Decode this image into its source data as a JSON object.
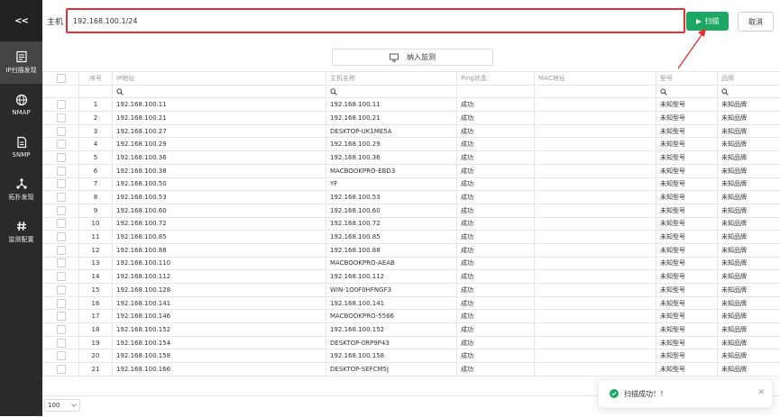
{
  "sidebar": {
    "collapse_label": "<<",
    "items": [
      {
        "label": "IP扫描发现",
        "icon": "scan-list-icon",
        "active": true
      },
      {
        "label": "NMAP",
        "icon": "globe-icon",
        "active": false
      },
      {
        "label": "SNMP",
        "icon": "snmp-doc-icon",
        "active": false
      },
      {
        "label": "拓扑发现",
        "icon": "topology-icon",
        "active": false
      },
      {
        "label": "监测配置",
        "icon": "hash-icon",
        "active": false
      }
    ]
  },
  "toolbar": {
    "host_label": "主机",
    "host_value": "192.168.100.1/24",
    "scan_label": "扫描",
    "cancel_label": "取消",
    "monitor_label": "纳入监测"
  },
  "table": {
    "columns": [
      "序号",
      "IP地址",
      "主机名称",
      "Ping状态",
      "MAC地址",
      "型号",
      "品牌"
    ],
    "rows": [
      [
        "1",
        "192.168.100.11",
        "192.168.100.11",
        "成功",
        "",
        "未知型号",
        "未知品牌"
      ],
      [
        "2",
        "192.168.100.21",
        "192.168.100.21",
        "成功",
        "",
        "未知型号",
        "未知品牌"
      ],
      [
        "3",
        "192.168.100.27",
        "DESKTOP-UK1ME5A",
        "成功",
        "",
        "未知型号",
        "未知品牌"
      ],
      [
        "4",
        "192.168.100.29",
        "192.168.100.29",
        "成功",
        "",
        "未知型号",
        "未知品牌"
      ],
      [
        "5",
        "192.168.100.36",
        "192.168.100.36",
        "成功",
        "",
        "未知型号",
        "未知品牌"
      ],
      [
        "6",
        "192.168.100.38",
        "MACBOOKPRO-EBD3",
        "成功",
        "",
        "未知型号",
        "未知品牌"
      ],
      [
        "7",
        "192.168.100.50",
        "YF",
        "成功",
        "",
        "未知型号",
        "未知品牌"
      ],
      [
        "8",
        "192.168.100.53",
        "192.168.100.53",
        "成功",
        "",
        "未知型号",
        "未知品牌"
      ],
      [
        "9",
        "192.168.100.60",
        "192.168.100.60",
        "成功",
        "",
        "未知型号",
        "未知品牌"
      ],
      [
        "10",
        "192.168.100.72",
        "192.168.100.72",
        "成功",
        "",
        "未知型号",
        "未知品牌"
      ],
      [
        "11",
        "192.168.100.85",
        "192.168.100.85",
        "成功",
        "",
        "未知型号",
        "未知品牌"
      ],
      [
        "12",
        "192.168.100.88",
        "192.168.100.88",
        "成功",
        "",
        "未知型号",
        "未知品牌"
      ],
      [
        "13",
        "192.168.100.110",
        "MACBOOKPRO-AEAB",
        "成功",
        "",
        "未知型号",
        "未知品牌"
      ],
      [
        "14",
        "192.168.100.112",
        "192.168.100.112",
        "成功",
        "",
        "未知型号",
        "未知品牌"
      ],
      [
        "15",
        "192.168.100.128",
        "WIN-1O0F0HFNGF3",
        "成功",
        "",
        "未知型号",
        "未知品牌"
      ],
      [
        "16",
        "192.168.100.141",
        "192.168.100.141",
        "成功",
        "",
        "未知型号",
        "未知品牌"
      ],
      [
        "17",
        "192.168.100.146",
        "MACBOOKPRO-5566",
        "成功",
        "",
        "未知型号",
        "未知品牌"
      ],
      [
        "18",
        "192.168.100.152",
        "192.168.100.152",
        "成功",
        "",
        "未知型号",
        "未知品牌"
      ],
      [
        "19",
        "192.168.100.154",
        "DESKTOP-0RP9P43",
        "成功",
        "",
        "未知型号",
        "未知品牌"
      ],
      [
        "20",
        "192.168.100.158",
        "192.168.100.158",
        "成功",
        "",
        "未知型号",
        "未知品牌"
      ],
      [
        "21",
        "192.168.100.166",
        "DESKTOP-SEFCM5J",
        "成功",
        "",
        "未知型号",
        "未知品牌"
      ]
    ]
  },
  "footer": {
    "page_size": "100"
  },
  "toast": {
    "message": "扫描成功！！"
  },
  "colors": {
    "sidebar_bg": "#2b2b2b",
    "accent_green": "#1aa862",
    "highlight_red": "#e03030"
  }
}
